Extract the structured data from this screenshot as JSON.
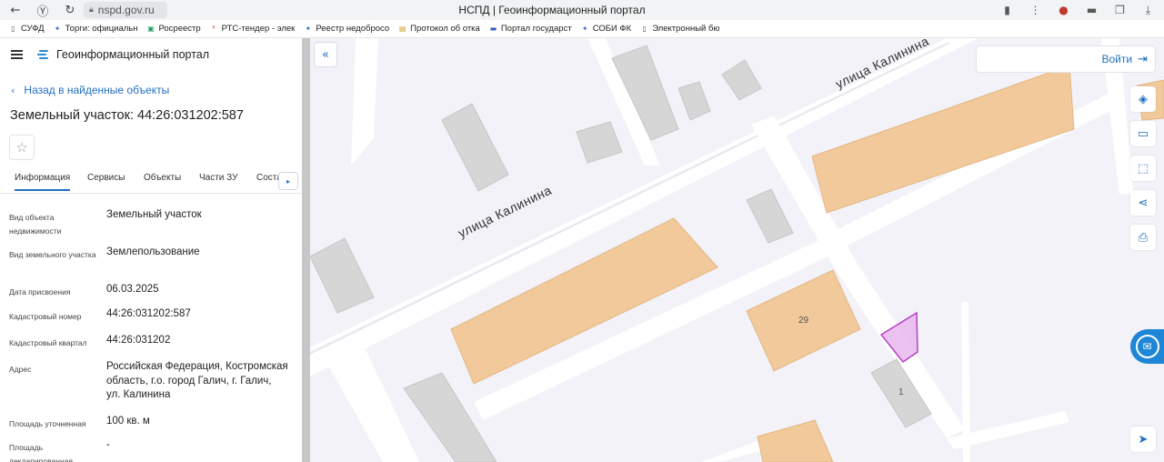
{
  "browser": {
    "url": "nspd.gov.ru",
    "page_title": "НСПД | Геоинформационный портал",
    "bookmarks": [
      {
        "label": "СУФД",
        "icon": "page-icon",
        "color": "#555555"
      },
      {
        "label": "Торги: официальн",
        "icon": "emblem-icon",
        "color": "#3a78c3"
      },
      {
        "label": "Росреестр",
        "icon": "rosreestr-icon",
        "color": "#2a9d6a"
      },
      {
        "label": "РТС-тендер - элек",
        "icon": "rts-icon",
        "color": "#d33a2c"
      },
      {
        "label": "Реестр недобросо",
        "icon": "emblem-icon",
        "color": "#3a78c3"
      },
      {
        "label": "Протокол об отка",
        "icon": "folder-icon",
        "color": "#c9a227"
      },
      {
        "label": "Портал государст",
        "icon": "flag-icon",
        "color": "#2b5fb3"
      },
      {
        "label": "СОБИ ФК",
        "icon": "emblem-icon",
        "color": "#3a78c3"
      },
      {
        "label": "Электронный бю",
        "icon": "page-icon",
        "color": "#555555"
      }
    ]
  },
  "panel": {
    "portal_name": "Геоинформационный портал",
    "back_label": "Назад в найденные объекты",
    "title": "Земельный участок: 44:26:031202:587",
    "tabs": [
      "Информация",
      "Сервисы",
      "Объекты",
      "Части ЗУ",
      "Соста"
    ],
    "active_tab": 0,
    "fields": [
      {
        "label": "Вид объекта недвижимости",
        "value": "Земельный участок"
      },
      {
        "label": "Вид земельного участка",
        "value": "Землепользование"
      },
      {
        "label": "Дата присвоения",
        "value": "06.03.2025"
      },
      {
        "label": "Кадастровый номер",
        "value": "44:26:031202:587"
      },
      {
        "label": "Кадастровый квартал",
        "value": "44:26:031202"
      },
      {
        "label": "Адрес",
        "value": "Российская Федерация, Костромская область, г.о. город Галич, г. Галич, ул. Калинина"
      },
      {
        "label": "Площадь уточненная",
        "value": "100 кв. м"
      },
      {
        "label": "Площадь декларированная",
        "value": "-"
      }
    ]
  },
  "map": {
    "street_label": "улица Калинина",
    "street_label_top": "улица Калинина",
    "house_29": "29",
    "house_1": "1",
    "login_label": "Войти",
    "colors": {
      "parcel": "#f2c99a",
      "building": "#d6d6d6",
      "selected": "#b542c4",
      "road": "#ffffff"
    }
  }
}
